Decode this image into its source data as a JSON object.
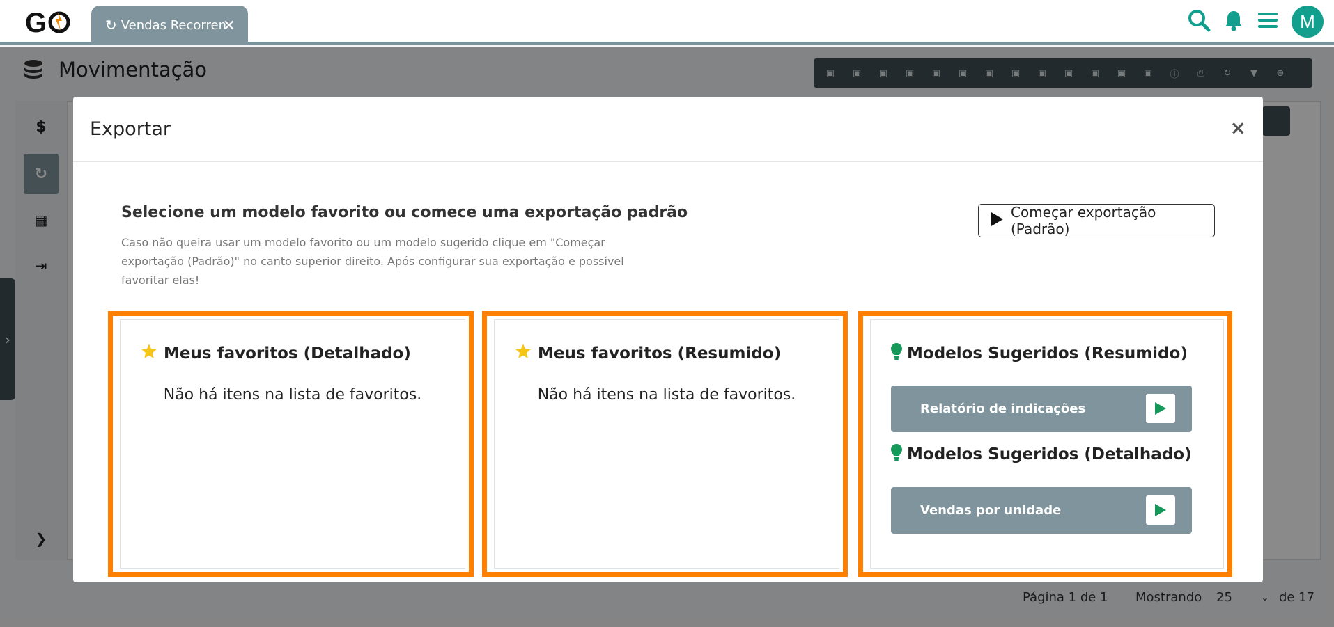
{
  "header": {
    "logo_text": "GO",
    "tab_label": "Vendas Recorrentes",
    "avatar_initial": "M"
  },
  "page": {
    "title": "Movimentação",
    "pager": {
      "page_label": "Página 1 de 1",
      "showing_label": "Mostrando",
      "page_size": "25",
      "total_label": "de 17"
    }
  },
  "modal": {
    "title": "Exportar",
    "close_symbol": "×",
    "intro_title": "Selecione um modelo favorito ou comece uma exportação padrão",
    "intro_desc": "Caso não queira usar um modelo favorito ou um modelo sugerido clique em \"Começar exportação (Padrão)\" no canto superior direito. Após configurar sua exportação e possível favoritar elas!",
    "start_button": "Começar exportação (Padrão)",
    "cards": {
      "detailed": {
        "title": "Meus favoritos (Detalhado)",
        "empty": "Não há itens na lista de favoritos."
      },
      "summary": {
        "title": "Meus favoritos (Resumido)",
        "empty": "Não há itens na lista de favoritos."
      },
      "suggested": {
        "summary_title": "Modelos Sugeridos (Resumido)",
        "summary_items": [
          "Relatório de indicações"
        ],
        "detailed_title": "Modelos Sugeridos (Detalhado)",
        "detailed_items": [
          "Vendas por unidade"
        ]
      }
    }
  },
  "colors": {
    "accent_teal": "#139f8e",
    "highlight_orange": "#ff8000",
    "suggest_item_bg": "#7f949c",
    "play_green": "#14995b",
    "star_yellow": "#f5c518"
  }
}
